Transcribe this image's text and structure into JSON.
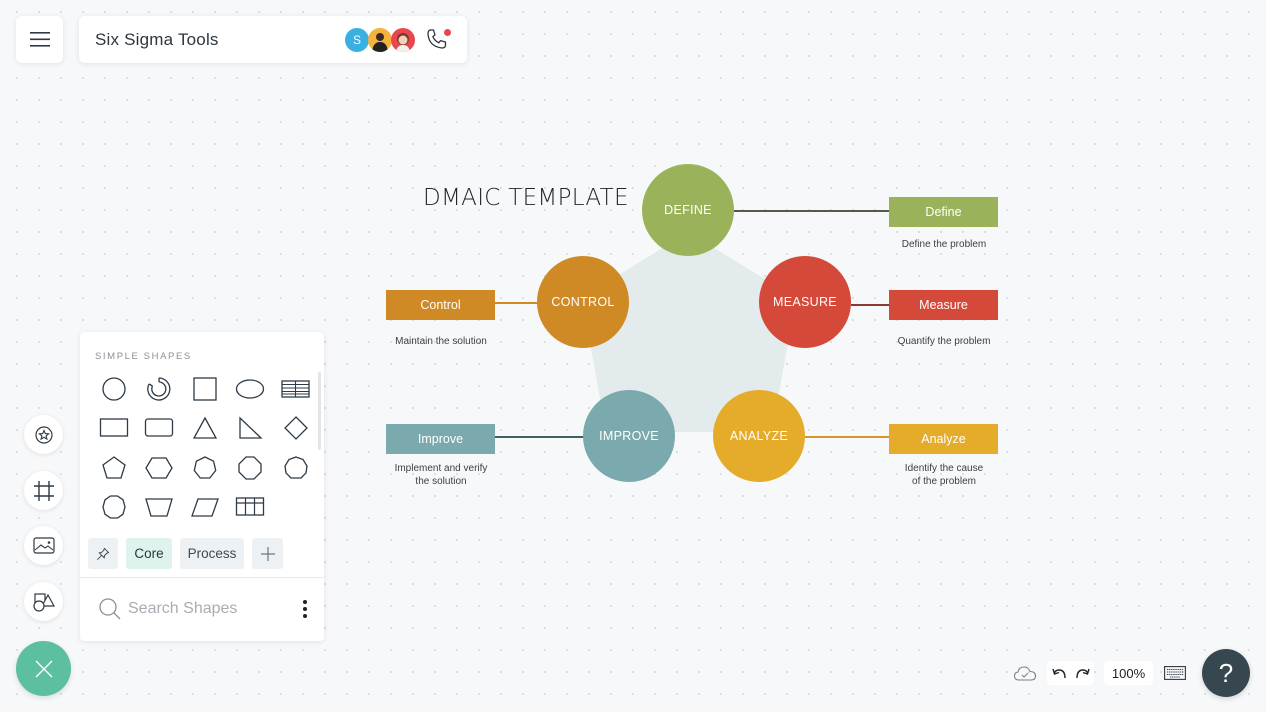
{
  "header": {
    "menu_icon": "hamburger-menu-icon",
    "title": "Six Sigma Tools",
    "collaborators": [
      {
        "initial": "S",
        "color": "#3ab0e2"
      },
      {
        "initial": "",
        "color": "#f3b33d"
      },
      {
        "initial": "",
        "color": "#e8474e"
      }
    ],
    "call_icon": "phone-icon",
    "call_status_color": "#e8474e"
  },
  "tool_rail": [
    {
      "name": "sticker-star-icon"
    },
    {
      "name": "frame-grid-icon"
    },
    {
      "name": "image-icon"
    },
    {
      "name": "shapes-icon"
    }
  ],
  "close_fab": {
    "icon": "close-icon",
    "color": "#5dbfa2"
  },
  "shapes_panel": {
    "heading": "SIMPLE SHAPES",
    "shapes": [
      "circle",
      "arc-ring",
      "square",
      "ellipse",
      "table",
      "rectangle",
      "rounded-rectangle",
      "triangle",
      "right-triangle",
      "diamond",
      "pentagon",
      "hexagon",
      "heptagon",
      "octagon",
      "nonagon",
      "decagon",
      "trapezoid",
      "parallelogram",
      "grid-table"
    ],
    "tabs": [
      {
        "icon": "pin-icon",
        "label": ""
      },
      {
        "label": "Core",
        "active": true
      },
      {
        "label": "Process"
      },
      {
        "icon": "plus-icon",
        "label": "+"
      }
    ],
    "search_placeholder": "Search Shapes",
    "search_value": ""
  },
  "diagram": {
    "title": "DMAIC TEMPLATE",
    "hub_color": "#e4ebed",
    "phases": [
      {
        "key": "define",
        "circle_label": "DEFINE",
        "tag_label": "Define",
        "description": [
          "Define the problem"
        ],
        "color": "#9ab35a",
        "line_color": "#5a5a44"
      },
      {
        "key": "measure",
        "circle_label": "MEASURE",
        "tag_label": "Measure",
        "description": [
          "Quantify the problem"
        ],
        "color": "#d4493a",
        "line_color": "#8a3a33"
      },
      {
        "key": "analyze",
        "circle_label": "ANALYZE",
        "tag_label": "Analyze",
        "description": [
          "Identify the cause",
          "of the problem"
        ],
        "color": "#e5ac2b",
        "line_color": "#d7962c"
      },
      {
        "key": "improve",
        "circle_label": "IMPROVE",
        "tag_label": "Improve",
        "description": [
          "Implement and verify",
          "the solution"
        ],
        "color": "#7aa9ae",
        "line_color": "#3b6266"
      },
      {
        "key": "control",
        "circle_label": "CONTROL",
        "tag_label": "Control",
        "description": [
          "Maintain the solution"
        ],
        "color": "#cf8a26",
        "line_color": "#cf8a26"
      }
    ]
  },
  "footer": {
    "cloud_icon": "cloud-saved-icon",
    "undo_icon": "undo-icon",
    "redo_icon": "redo-icon",
    "zoom_level": "100%",
    "keyboard_icon": "keyboard-icon",
    "help_label": "?"
  }
}
